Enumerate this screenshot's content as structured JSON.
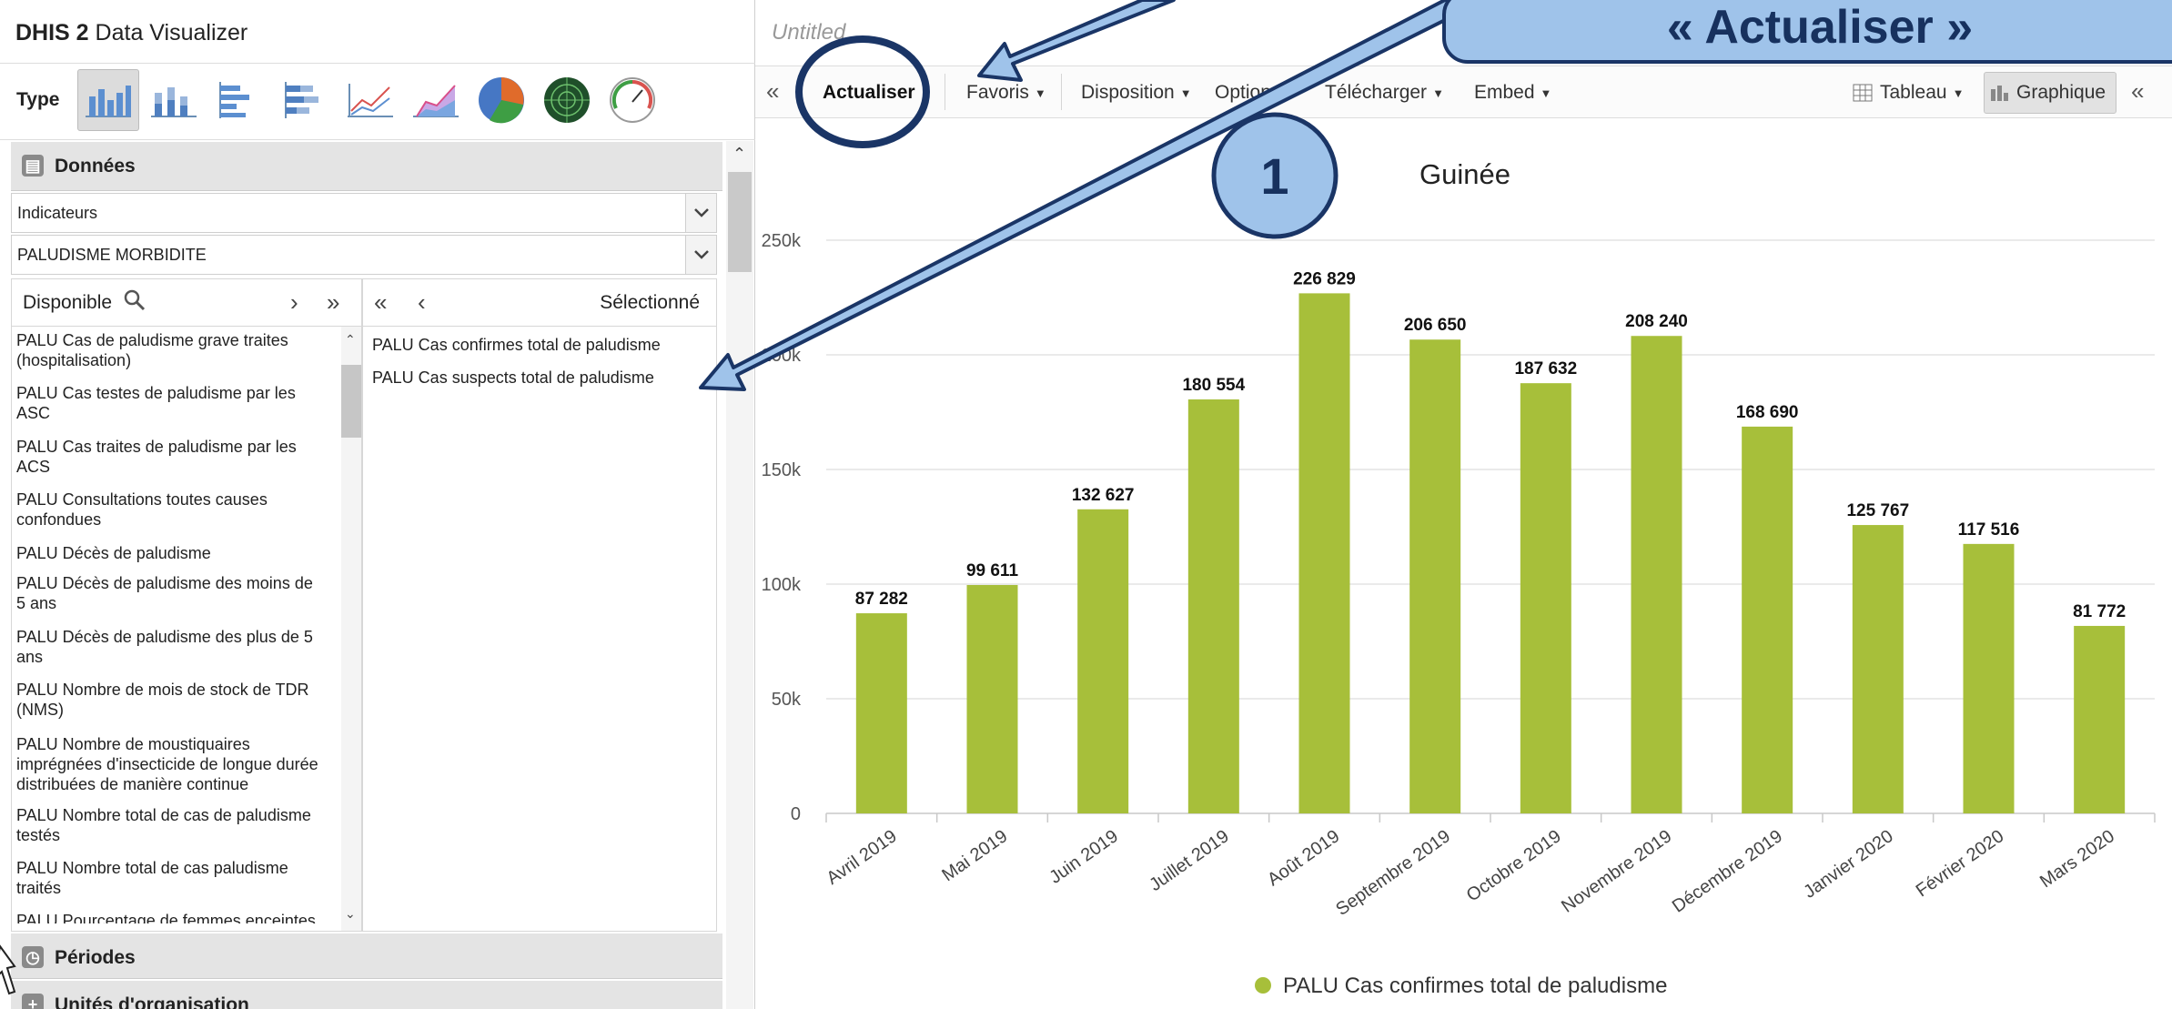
{
  "app": {
    "brand": "DHIS 2",
    "name": "Data Visualizer"
  },
  "type_label": "Type",
  "type_icons": [
    "column-chart-icon",
    "stacked-column-icon",
    "bar-chart-icon",
    "stacked-bar-icon",
    "line-chart-icon",
    "area-chart-icon",
    "pie-chart-icon",
    "radar-chart-icon",
    "gauge-chart-icon"
  ],
  "data_section": {
    "title": "Données",
    "group_type": "Indicateurs",
    "group": "PALUDISME MORBIDITE",
    "available_label": "Disponible",
    "selected_label": "Sélectionné",
    "available": [
      "PALU Cas de paludisme grave traites (hospitalisation)",
      "PALU Cas testes de paludisme par les ASC",
      "PALU Cas traites de paludisme par les ACS",
      "PALU Consultations toutes causes confondues",
      "PALU Décès de paludisme",
      "PALU Décès de paludisme des moins de 5 ans",
      "PALU Décès de paludisme des plus de 5 ans",
      "PALU Nombre de mois de stock de TDR (NMS)",
      "PALU Nombre de moustiquaires imprégnées d'insecticide de longue durée distribuées de manière continue",
      "PALU Nombre total de cas de paludisme testés",
      "PALU Nombre total de cas paludisme traités",
      "PALU Pourcentage de femmes enceintes"
    ],
    "selected": [
      "PALU Cas confirmes total de paludisme",
      "PALU Cas suspects total de paludisme"
    ]
  },
  "periods_section": {
    "title": "Périodes"
  },
  "org_section": {
    "title": "Unités d'organisation"
  },
  "workspace": {
    "title": "Untitled"
  },
  "toolbar": {
    "collapse_left": "«",
    "update": "Actualiser",
    "favorites": "Favoris",
    "layout": "Disposition",
    "options": "Options",
    "download": "Télécharger",
    "embed": "Embed",
    "table": "Tableau",
    "chart": "Graphique",
    "collapse_right": "«"
  },
  "annotation": {
    "callout": "« Actualiser »",
    "step": "1"
  },
  "colors": {
    "bar": "#a7bf3a",
    "accent": "#1a3566",
    "callout_fill": "#9fc3ea"
  },
  "chart_data": {
    "type": "bar",
    "title": "Guinée",
    "categories": [
      "Avril 2019",
      "Mai 2019",
      "Juin 2019",
      "Juillet 2019",
      "Août 2019",
      "Septembre 2019",
      "Octobre 2019",
      "Novembre 2019",
      "Décembre 2019",
      "Janvier 2020",
      "Février 2020",
      "Mars 2020"
    ],
    "series": [
      {
        "name": "PALU Cas confirmes total de paludisme",
        "values": [
          87282,
          99611,
          132627,
          180554,
          226829,
          206650,
          187632,
          208240,
          168690,
          125767,
          117516,
          81772
        ]
      }
    ],
    "data_labels": [
      "87 282",
      "99 611",
      "132 627",
      "180 554",
      "226 829",
      "206 650",
      "187 632",
      "208 240",
      "168 690",
      "125 767",
      "117 516",
      "81 772"
    ],
    "yticks": [
      "0",
      "50k",
      "100k",
      "150k",
      "200k",
      "250k"
    ],
    "ylim": [
      0,
      250000
    ],
    "grid": true,
    "legend": "bottom-center"
  }
}
